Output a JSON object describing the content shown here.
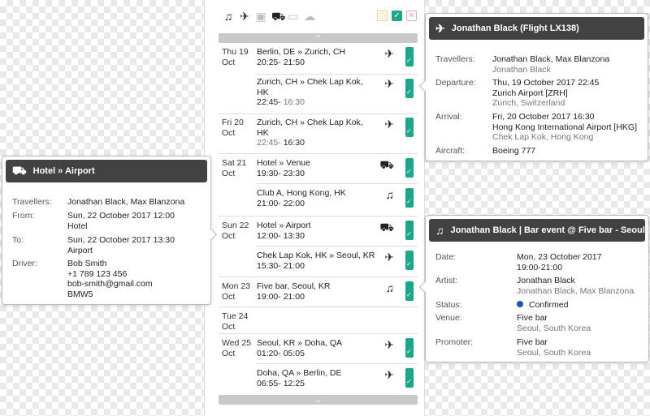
{
  "toolbar": {
    "icons": [
      "music-icon",
      "plane-icon",
      "train-icon",
      "car-icon",
      "bed-icon",
      "cloud-icon"
    ],
    "status_icons": [
      "clock",
      "check",
      "close"
    ],
    "scroll_up": "⌃",
    "scroll_down": "⌄"
  },
  "days": [
    {
      "day": "Thu 19",
      "month": "Oct"
    },
    {
      "day": "Fri 20",
      "month": "Oct"
    },
    {
      "day": "Sat 21",
      "month": "Oct"
    },
    {
      "day": "Sun 22",
      "month": "Oct"
    },
    {
      "day": "Mon 23",
      "month": "Oct"
    },
    {
      "day": "Tue 24",
      "month": "Oct"
    },
    {
      "day": "Wed 25",
      "month": "Oct"
    }
  ],
  "events": [
    {
      "route": "Berlin, DE » Zurich, CH",
      "time": "20:25- 21:50",
      "time_end_dim": ""
    },
    {
      "route": "Zurich, CH » Chek Lap Kok,",
      "route2": "HK",
      "time": "22:45- ",
      "time_end_dim": "16:30"
    },
    {
      "route": "Zurich, CH » Chek Lap Kok,",
      "route2": "HK",
      "time": "22:45- ",
      "time_end_dim": "16:30",
      "time_start_dim": true
    },
    {
      "route": "Hotel » Venue",
      "time": "19:30- 23:30",
      "time_end_dim": ""
    },
    {
      "route": "Club A, Hong Kong, HK",
      "time": "21:00- 22:00",
      "time_end_dim": ""
    },
    {
      "route": "Hotel » Airport",
      "time": "12:00- 13:30",
      "time_end_dim": ""
    },
    {
      "route": "Chek Lap Kok, HK » Seoul, KR",
      "time": "15:30- 21:00",
      "time_end_dim": ""
    },
    {
      "route": "Five bar, Seoul, KR",
      "time": "19:00- 21:00",
      "time_end_dim": ""
    },
    {
      "route": "Seoul, KR » Doha, QA",
      "time": "01:20- 05:05",
      "time_end_dim": ""
    },
    {
      "route": "Doha, QA » Berlin, DE",
      "time": "06:55- 12:25",
      "time_end_dim": ""
    }
  ],
  "flight_popover": {
    "title": "Jonathan Black (Flight LX138)",
    "travellers_label": "Travellers:",
    "travellers": "Jonathan Black, Max Blanzona",
    "travellers_sub": "Jonathan Black",
    "departure_label": "Departure:",
    "departure_date": "Thu, 19 October 2017 22:45",
    "departure_airport": "Zurich Airport [ZRH]",
    "departure_city": "Zurich, Switzerland",
    "arrival_label": "Arrival:",
    "arrival_date": "Fri, 20 October 2017 16:30",
    "arrival_airport": "Hong Kong International Airport [HKG]",
    "arrival_city": "Chek Lap Kok, Hong Kong",
    "aircraft_label": "Aircraft:",
    "aircraft": "Boeing 777"
  },
  "hotel_popover": {
    "title": "Hotel » Airport",
    "travellers_label": "Travellers:",
    "travellers": "Jonathan Black, Max Blanzona",
    "from_label": "From:",
    "from_date": "Sun, 22 October 2017 12:00",
    "from_place": "Hotel",
    "to_label": "To:",
    "to_date": "Sun, 22 October 2017 13:30",
    "to_place": "Airport",
    "driver_label": "Driver:",
    "driver_name": "Bob Smith",
    "driver_phone": "+1 789 123 456",
    "driver_email": "bob-smith@gmail.com",
    "driver_car": "BMW5"
  },
  "bar_popover": {
    "title": "Jonathan Black | Bar event @ Five bar - Seoul",
    "date_label": "Date:",
    "date": "Mon, 23 October 2017",
    "time": "19:00-21:00",
    "artist_label": "Artist:",
    "artist": "Jonathan Black",
    "artist_sub": "Jonathan Black, Max Blanzona",
    "status_label": "Status:",
    "status": "Confirmed",
    "venue_label": "Venue:",
    "venue": "Five bar",
    "venue_city": "Seoul, South Korea",
    "promoter_label": "Promoter:",
    "promoter": "Five bar",
    "promoter_city": "Seoul, South Korea"
  },
  "colors": {
    "accent": "#1aa78a",
    "header_bg": "#424242",
    "status_dot": "#1559b5"
  }
}
